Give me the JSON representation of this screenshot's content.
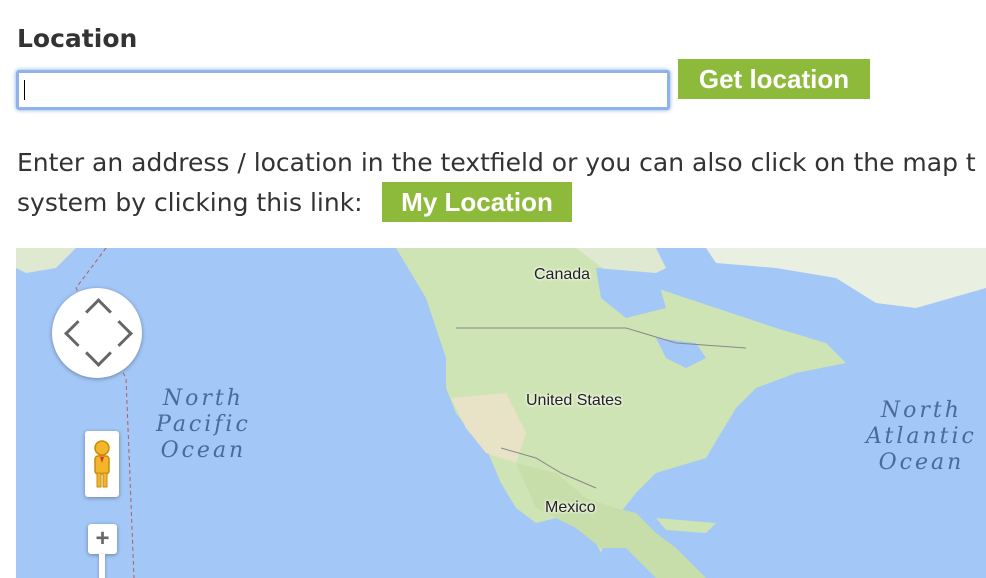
{
  "form": {
    "label": "Location",
    "input_value": "",
    "get_location_label": "Get location"
  },
  "description": {
    "line1": "Enter an address / location in the textfield or you can also click on the map t",
    "line2": "system by clicking this link:",
    "my_location_label": "My Location"
  },
  "map": {
    "labels": {
      "north_pacific": [
        "North",
        "Pacific",
        "Ocean"
      ],
      "north_atlantic": [
        "North",
        "Atlantic",
        "Ocean"
      ],
      "canada": "Canada",
      "united_states": "United States",
      "mexico": "Mexico"
    },
    "controls": {
      "pan_icon": "pan-control-icon",
      "pegman_icon": "pegman-icon",
      "zoom_in_label": "+"
    }
  },
  "colors": {
    "button": "#8dba3a",
    "water": "#a3c7f7",
    "land": "#cfe4b4",
    "input_focus": "#8fb2e8"
  }
}
